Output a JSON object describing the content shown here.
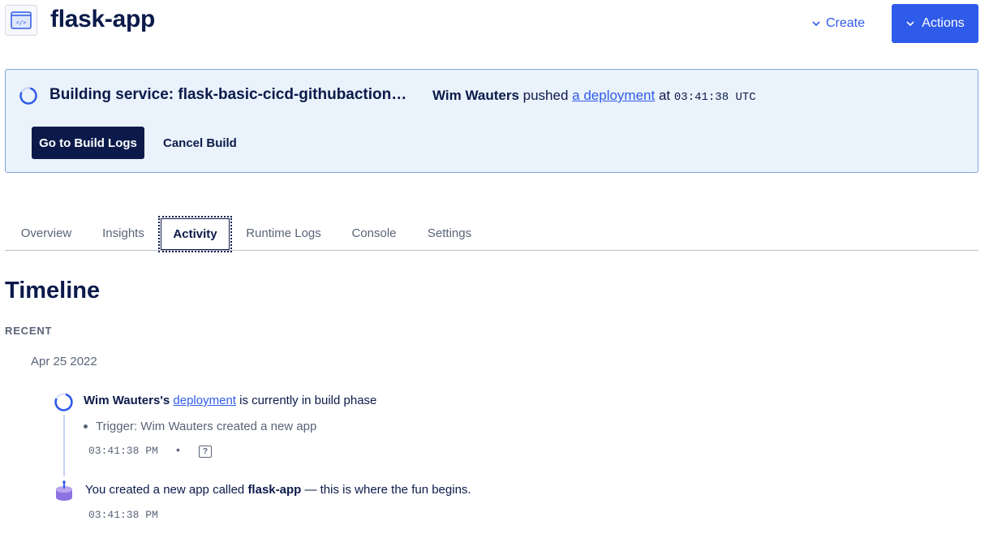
{
  "header": {
    "app_name": "flask-app",
    "create_label": "Create",
    "actions_label": "Actions"
  },
  "banner": {
    "title": "Building service: flask-basic-cicd-githubactions-d...",
    "author": "Wim Wauters",
    "pushed_text": "pushed",
    "link_text": "a deployment",
    "at_text": "at",
    "time": "03:41:38 UTC",
    "go_logs_label": "Go to Build Logs",
    "cancel_label": "Cancel Build"
  },
  "tabs": [
    {
      "label": "Overview",
      "active": false
    },
    {
      "label": "Insights",
      "active": false
    },
    {
      "label": "Activity",
      "active": true
    },
    {
      "label": "Runtime Logs",
      "active": false
    },
    {
      "label": "Console",
      "active": false
    },
    {
      "label": "Settings",
      "active": false
    }
  ],
  "timeline": {
    "heading": "Timeline",
    "section_label": "RECENT",
    "date": "Apr 25 2022",
    "events": [
      {
        "author": "Wim Wauters's",
        "link_text": "deployment",
        "suffix": "is currently in build phase",
        "trigger": "Trigger: Wim Wauters created a new app",
        "time": "03:41:38 PM",
        "separator": "•",
        "help": "?"
      },
      {
        "prefix": "You created a new app called",
        "app_name": "flask-app",
        "suffix": "— this is where the fun begins.",
        "time": "03:41:38 PM"
      }
    ]
  },
  "colors": {
    "primary": "#2f5bea",
    "navy": "#0b1a4a",
    "banner_bg": "#eaf2fb",
    "banner_border": "#7fa7da",
    "muted": "#5a6478"
  }
}
